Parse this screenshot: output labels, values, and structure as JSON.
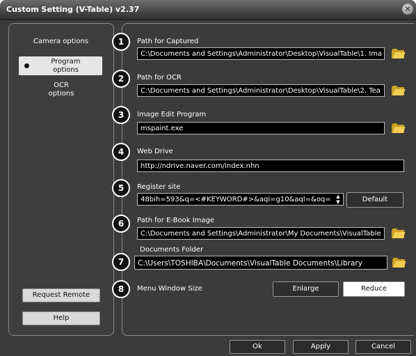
{
  "window": {
    "title": "Custom Setting (V-Table) v2.37",
    "close_glyph": "×"
  },
  "sidebar": {
    "camera_options": "Camera options",
    "program_options": "Program options",
    "ocr_options": "OCR options",
    "request_remote": "Request Remote",
    "help": "Help"
  },
  "settings": [
    {
      "num": "1",
      "label": "Path for Captured",
      "value": "C:\\Documents and Settings\\Administrator\\Desktop\\VisualTable\\1. Ima"
    },
    {
      "num": "2",
      "label": "Path for OCR",
      "value": "C:\\Documents and Settings\\Administrator\\Desktop\\VisualTable\\2. Tea"
    },
    {
      "num": "3",
      "label": "Image Edit Program",
      "value": "mspaint.exe"
    },
    {
      "num": "4",
      "label": "Web Drive",
      "value": "http://ndrive.naver.com/index.nhn"
    },
    {
      "num": "5",
      "label": "Register site",
      "value": "48bih=593&q=<#KEYWORD#>&aqi=g10&aql=&oq="
    },
    {
      "num": "6",
      "label": "Path for E-Book Image",
      "value": "C:\\Documents and Settings\\Administrator\\My Documents\\VisualTable"
    },
    {
      "num": "7",
      "label": "Documents Folder",
      "value": "C:\\Users\\TOSHIBA\\Documents\\VisualTable Documents\\Library"
    },
    {
      "num": "8",
      "label": "Menu Window Size"
    }
  ],
  "register_site": {
    "default_label": "Default",
    "spin_up": "▲",
    "spin_down": "▼"
  },
  "menu_size": {
    "enlarge": "Enlarge",
    "reduce": "Reduce",
    "selected": "Reduce"
  },
  "footer": {
    "ok": "Ok",
    "apply": "Apply",
    "cancel": "Cancel"
  },
  "colors": {
    "window_bg": "#3b3b3b",
    "folder_icon": "#f2cf54",
    "field_bg": "#000000"
  }
}
